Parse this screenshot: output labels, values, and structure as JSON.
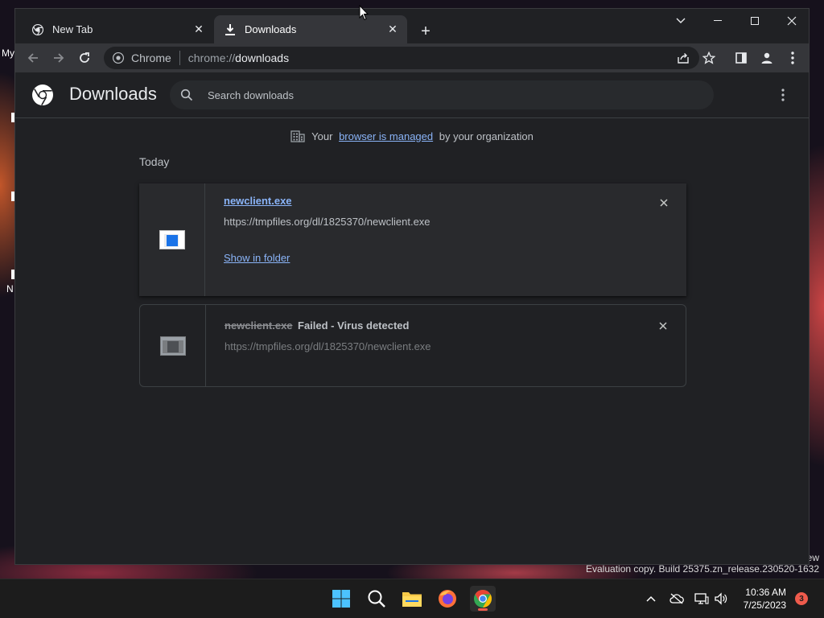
{
  "desktop": {
    "icon_label_top": "My",
    "icon_label_bottom": "N",
    "watermark_right": "ew",
    "watermark": "Evaluation copy. Build 25375.zn_release.230520-1632"
  },
  "tabs": [
    {
      "title": "New Tab",
      "icon": "chrome-icon",
      "active": false
    },
    {
      "title": "Downloads",
      "icon": "download-icon",
      "active": true
    }
  ],
  "toolbar": {
    "chip_label": "Chrome",
    "url_scheme": "chrome://",
    "url_path": "downloads"
  },
  "downloads": {
    "page_title": "Downloads",
    "search_placeholder": "Search downloads",
    "managed_prefix": "Your ",
    "managed_link": "browser is managed",
    "managed_suffix": " by your organization",
    "section_label": "Today",
    "items": [
      {
        "filename": "newclient.exe",
        "url": "https://tmpfiles.org/dl/1825370/newclient.exe",
        "action": "Show in folder",
        "status": "",
        "failed": false
      },
      {
        "filename": "newclient.exe",
        "url": "https://tmpfiles.org/dl/1825370/newclient.exe",
        "action": "",
        "status": "Failed - Virus detected",
        "failed": true
      }
    ]
  },
  "taskbar": {
    "time": "10:36 AM",
    "date": "7/25/2023",
    "notification_count": "3",
    "apps": [
      "start-icon",
      "search-icon",
      "file-explorer-icon",
      "firefox-icon",
      "chrome-icon"
    ]
  },
  "colors": {
    "link": "#8ab4f8",
    "window_bg": "#202124",
    "toolbar_bg": "#35363a",
    "notification": "#ef5b4c"
  }
}
